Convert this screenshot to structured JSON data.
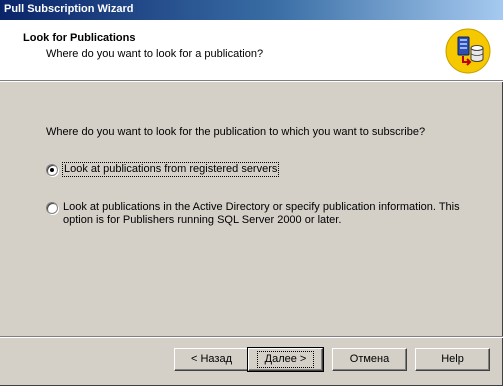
{
  "window": {
    "title": "Pull Subscription Wizard"
  },
  "header": {
    "title": "Look for Publications",
    "subtitle": "Where do you want to look for a publication?",
    "icon": "database-server-icon"
  },
  "main": {
    "question": "Where do you want to look for the publication to which you want to subscribe?",
    "options": [
      {
        "label": "Look at publications from registered servers",
        "selected": true
      },
      {
        "label": "Look at publications in the Active Directory or specify publication information. This option is for Publishers running SQL Server 2000 or later.",
        "selected": false
      }
    ]
  },
  "buttons": {
    "back": "< Назад",
    "next": "Далее >",
    "cancel": "Отмена",
    "help": "Help"
  },
  "colors": {
    "titlebar_start": "#0a246a",
    "titlebar_end": "#a6caf0",
    "dialog_face": "#d4d0c8",
    "icon_yellow": "#f5c800"
  }
}
